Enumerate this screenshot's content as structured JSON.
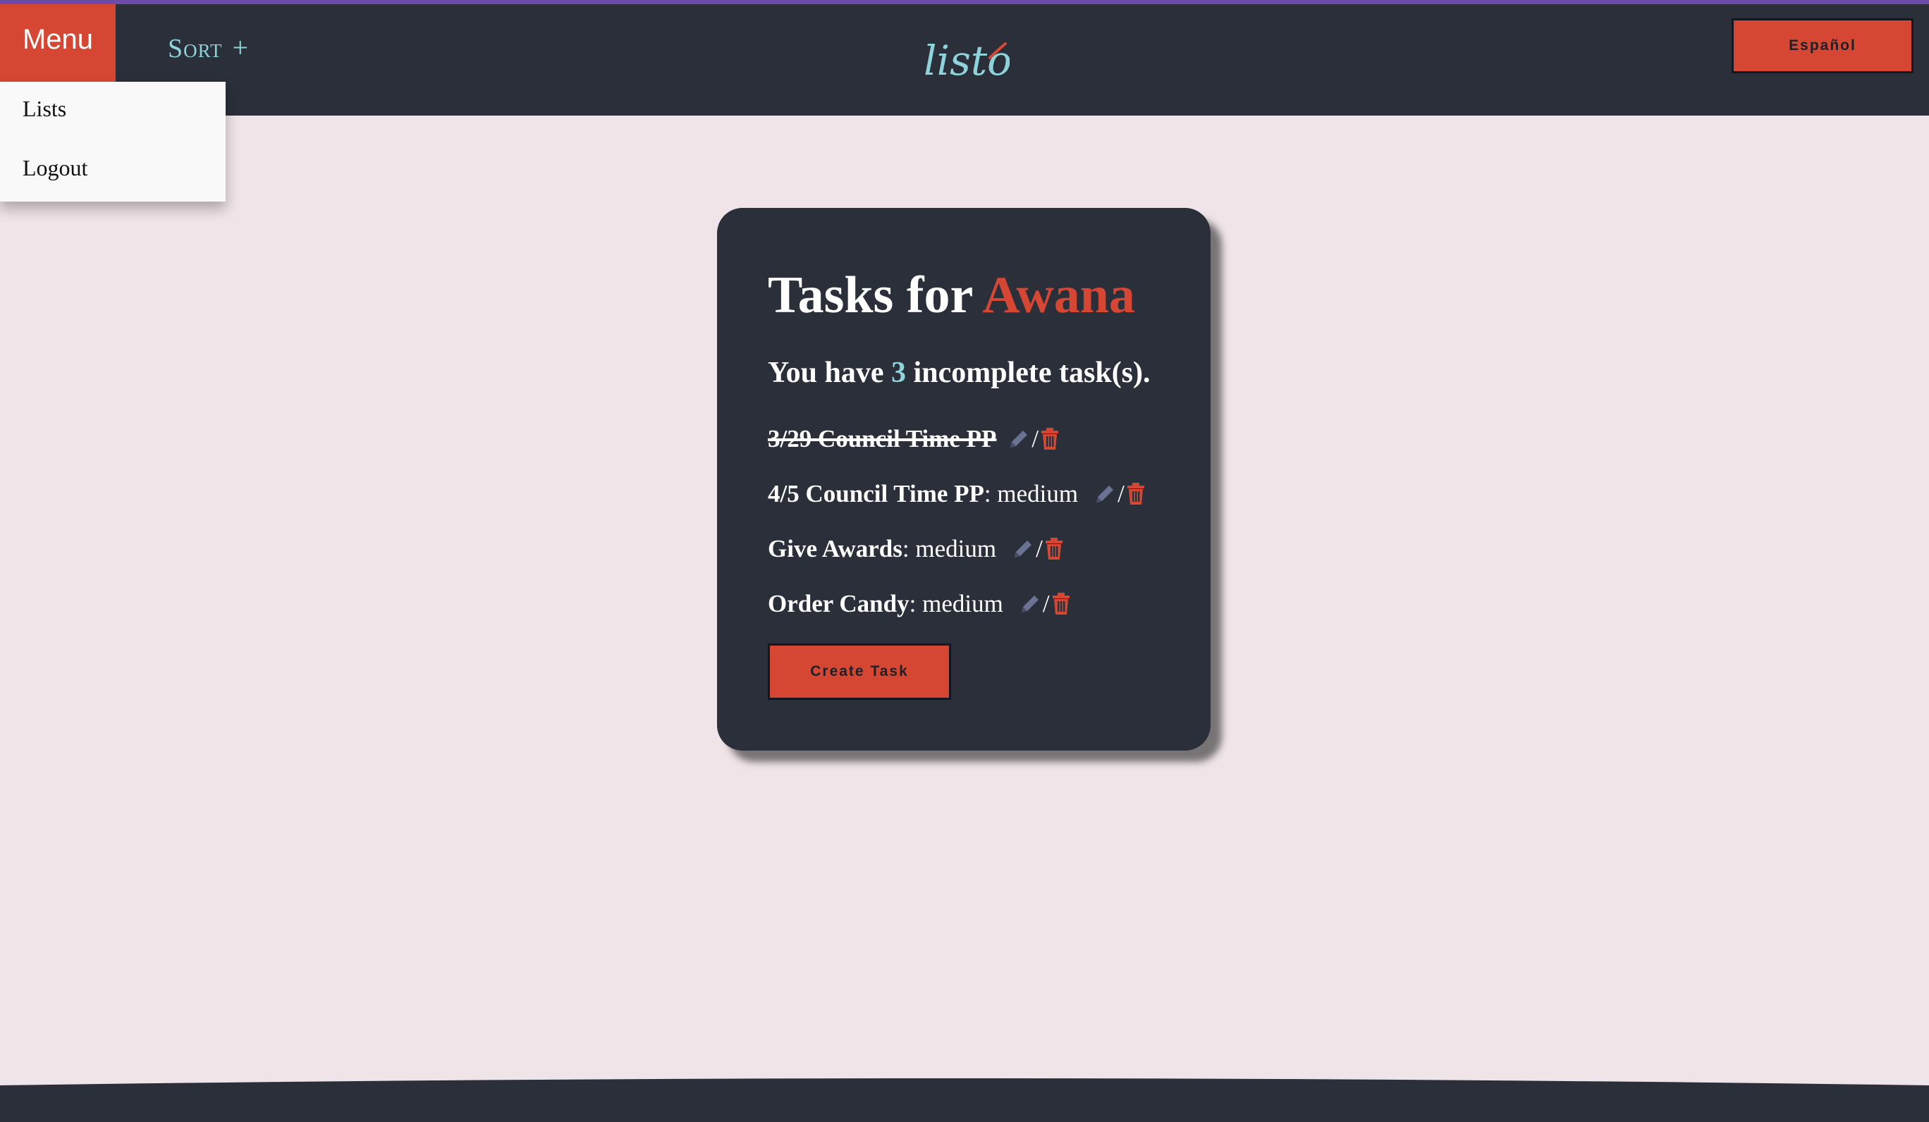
{
  "header": {
    "menu_label": "Menu",
    "sort_label": "Sort",
    "add_label": "+",
    "logo_text": "listo",
    "language_button": "Español"
  },
  "menu": {
    "items": [
      {
        "label": "Lists"
      },
      {
        "label": "Logout"
      }
    ]
  },
  "card": {
    "title_prefix": "Tasks for ",
    "list_name": "Awana",
    "summary_prefix": "You have ",
    "incomplete_count": "3",
    "summary_suffix": " incomplete task(s).",
    "tasks": [
      {
        "name": "3/29 Council Time PP",
        "priority": "",
        "completed": true
      },
      {
        "name": "4/5 Council Time PP",
        "priority": ": medium",
        "completed": false
      },
      {
        "name": "Give Awards",
        "priority": ": medium",
        "completed": false
      },
      {
        "name": "Order Candy",
        "priority": ": medium",
        "completed": false
      }
    ],
    "separator": "/",
    "create_button": "Create Task"
  },
  "colors": {
    "navbar": "#2b2f3a",
    "accent_red": "#d64733",
    "accent_teal": "#8fd3da",
    "background": "#efe4e8",
    "top_line": "#6b4aa8"
  }
}
